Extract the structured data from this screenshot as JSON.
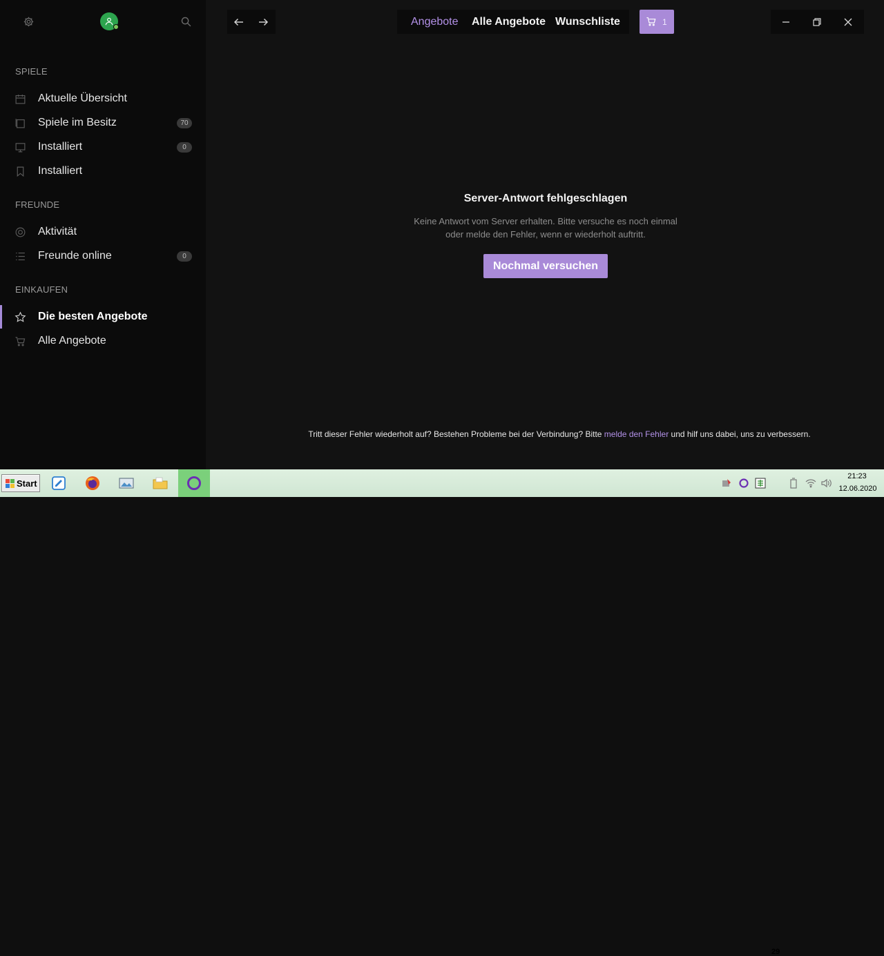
{
  "sidebar": {
    "sections": {
      "games": "SPIELE",
      "friends": "FREUNDE",
      "shop": "EINKAUFEN"
    },
    "games_items": [
      {
        "label": "Aktuelle Übersicht",
        "icon": "calendar-icon",
        "badge": ""
      },
      {
        "label": "Spiele im Besitz",
        "icon": "library-icon",
        "badge": "70"
      },
      {
        "label": "Installiert",
        "icon": "monitor-icon",
        "badge": "0"
      },
      {
        "label": "Installiert",
        "icon": "bookmark-icon",
        "badge": ""
      }
    ],
    "friends_items": [
      {
        "label": "Aktivität",
        "icon": "activity-icon",
        "badge": ""
      },
      {
        "label": "Freunde online",
        "icon": "list-icon",
        "badge": "0"
      }
    ],
    "shop_items": [
      {
        "label": "Die besten Angebote",
        "icon": "star-icon",
        "active": true
      },
      {
        "label": "Alle Angebote",
        "icon": "cart-icon",
        "active": false
      }
    ]
  },
  "topbar": {
    "tabs": [
      "Angebote",
      "Alle Angebote",
      "Wunschliste"
    ],
    "active_tab": 0,
    "cart_count": "1"
  },
  "main": {
    "error_title": "Server-Antwort fehlgeschlagen",
    "error_line1": "Keine Antwort vom Server erhalten. Bitte versuche es noch einmal",
    "error_line2": "oder melde den Fehler, wenn er wiederholt auftritt.",
    "retry_label": "Nochmal versuchen",
    "footer_before": "Tritt dieser Fehler wiederholt auf? Bestehen Probleme bei der Verbindung? Bitte ",
    "footer_link": "melde den Fehler",
    "footer_after": " und hilf uns dabei, uns zu verbessern."
  },
  "taskbar": {
    "start_label": "Start",
    "tray_number": "29",
    "time": "21:23",
    "date": "12.06.2020"
  },
  "colors": {
    "accent": "#a98ad8",
    "accent_text": "#b391e8",
    "avatar": "#2da44e"
  }
}
